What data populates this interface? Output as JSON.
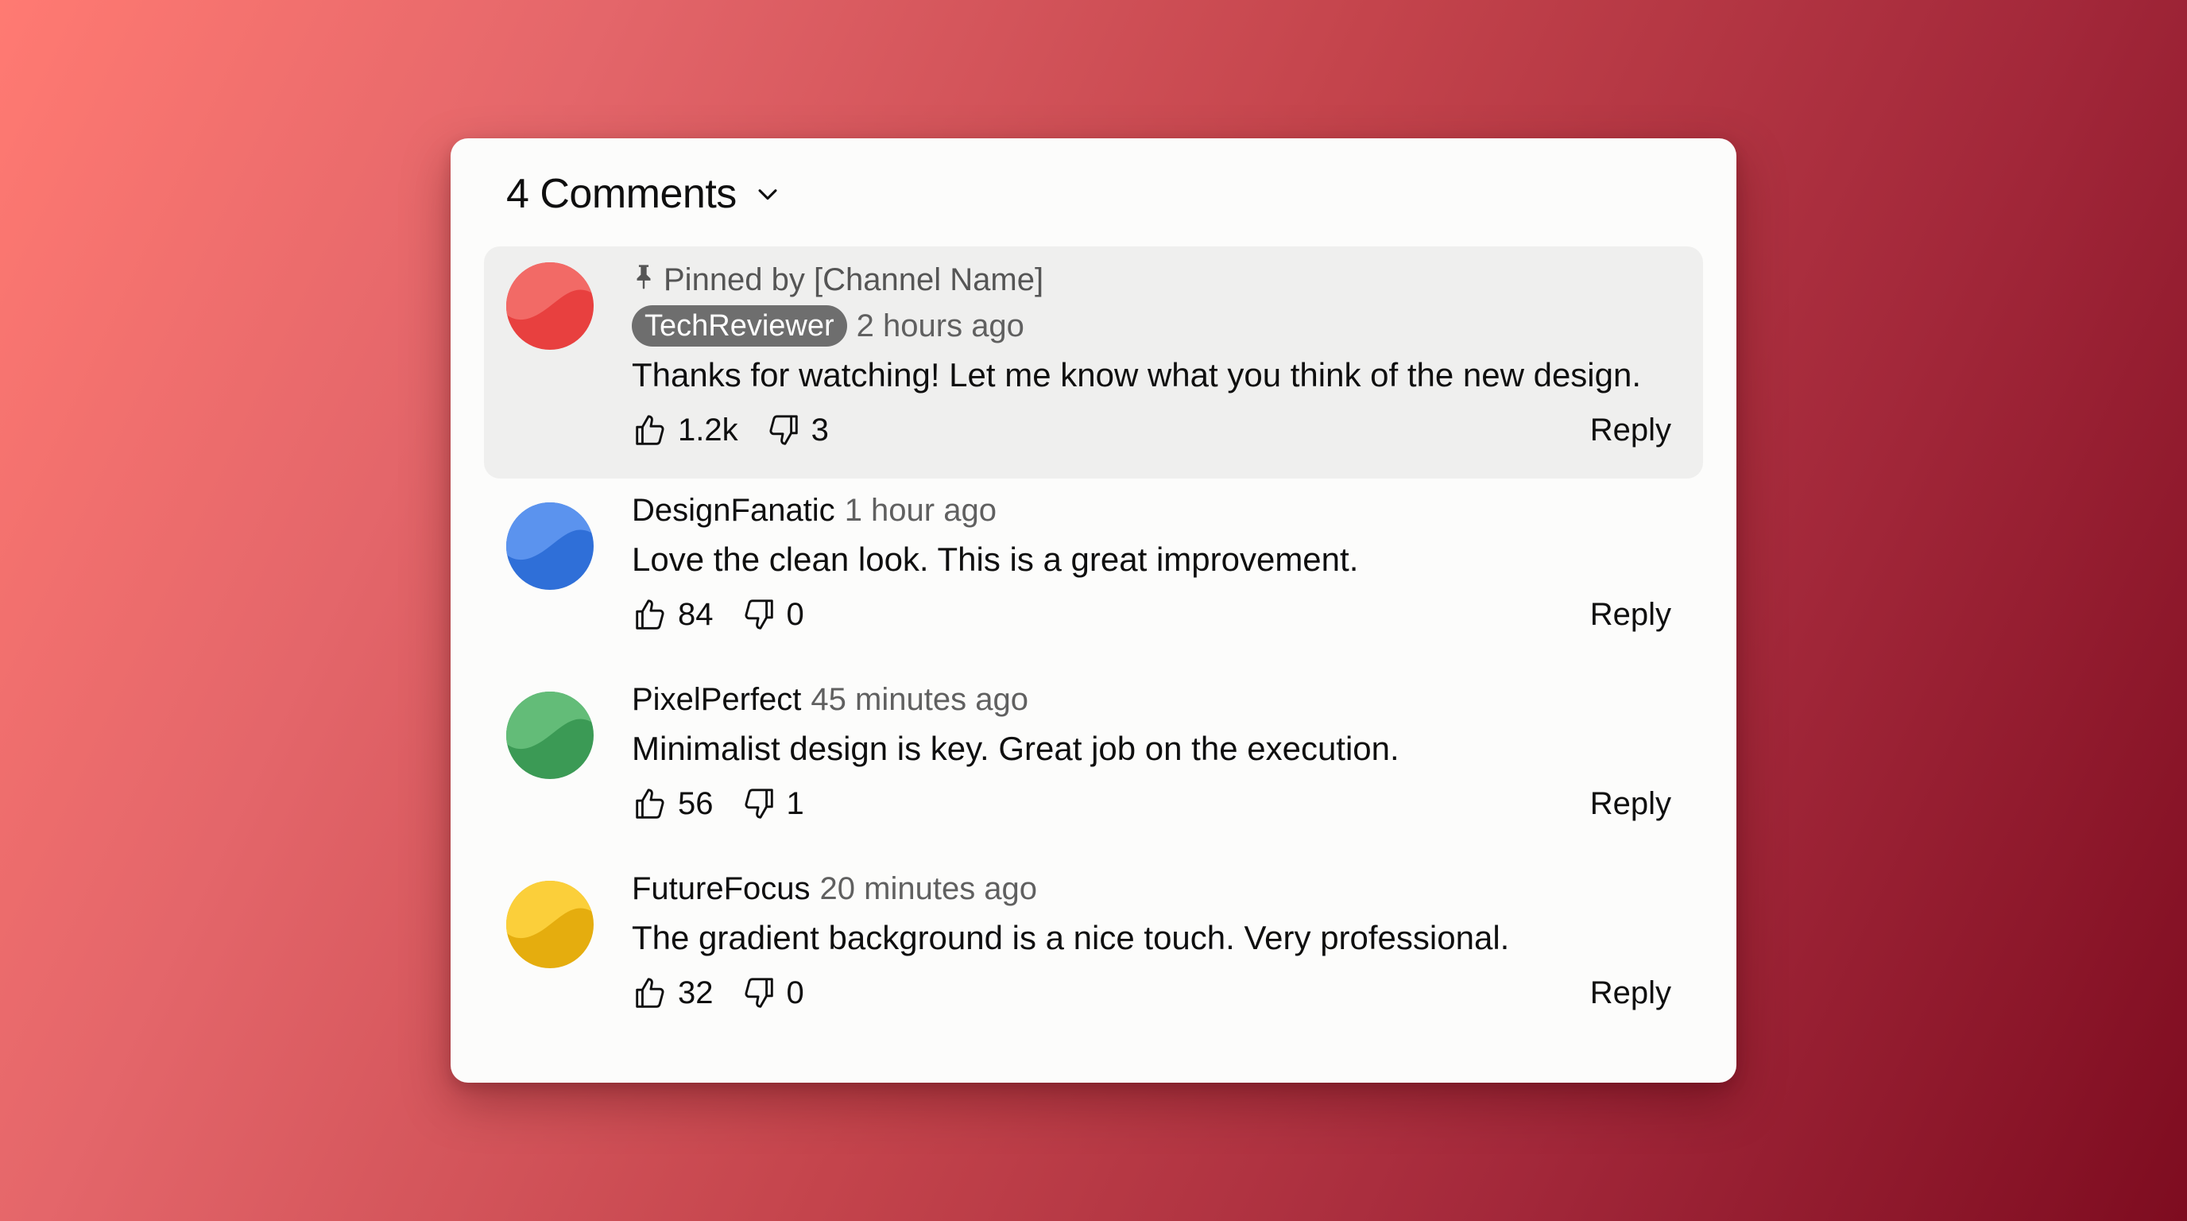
{
  "header": {
    "title": "4 Comments"
  },
  "comments": [
    {
      "pinned_label": "Pinned by [Channel Name]",
      "author": "TechReviewer",
      "time": "2 hours ago",
      "text": "Thanks for watching! Let me know what you think of the new design.",
      "likes": "1.2k",
      "dislikes": "3",
      "reply_label": "Reply",
      "avatar_colors": [
        "#e8403f",
        "#f26a66"
      ]
    },
    {
      "author": "DesignFanatic",
      "time": "1 hour ago",
      "text": "Love the clean look. This is a great improvement.",
      "likes": "84",
      "dislikes": "0",
      "reply_label": "Reply",
      "avatar_colors": [
        "#2f6fd8",
        "#5b93ee"
      ]
    },
    {
      "author": "PixelPerfect",
      "time": "45 minutes ago",
      "text": "Minimalist design is key. Great job on the execution.",
      "likes": "56",
      "dislikes": "1",
      "reply_label": "Reply",
      "avatar_colors": [
        "#3b9a55",
        "#63bc78"
      ]
    },
    {
      "author": "FutureFocus",
      "time": "20 minutes ago",
      "text": "The gradient background is a nice touch. Very professional.",
      "likes": "32",
      "dislikes": "0",
      "reply_label": "Reply",
      "avatar_colors": [
        "#e5ad0e",
        "#fbcf3a"
      ]
    }
  ],
  "icons": {
    "sort": "chevron-down-icon",
    "pin": "pin-icon",
    "like": "thumbs-up-icon",
    "dislike": "thumbs-down-icon"
  },
  "colors": {
    "background_start": "#ff7a72",
    "background_end": "#7e0c20",
    "panel": "#fcfcfb",
    "pinned_highlight": "#efefee",
    "author_chip": "#6e6e6e"
  }
}
